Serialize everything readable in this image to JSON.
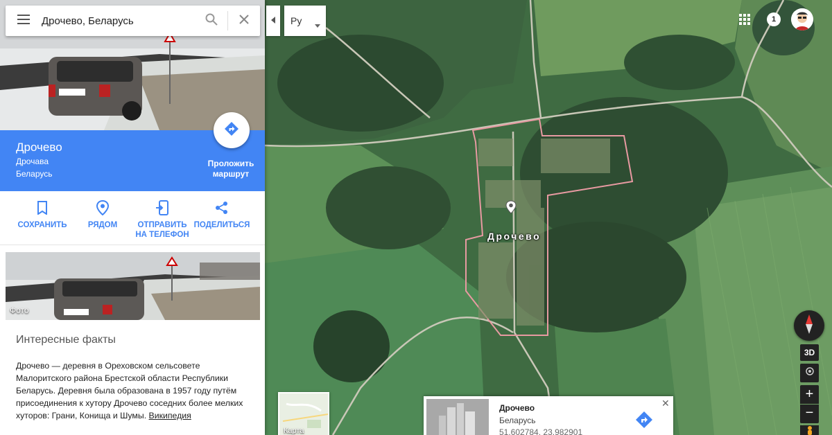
{
  "search": {
    "value": "Дрочево, Беларусь"
  },
  "place": {
    "title": "Дрочево",
    "subtitle": "Дрочава",
    "country": "Беларусь",
    "directions_label": "Проложить\nмаршрут"
  },
  "actions": [
    {
      "label": "СОХРАНИТЬ",
      "icon": "bookmark-icon"
    },
    {
      "label": "РЯДОМ",
      "icon": "nearby-icon"
    },
    {
      "label": "ОТПРАВИТЬ\nНА ТЕЛЕФОН",
      "icon": "send-to-phone-icon"
    },
    {
      "label": "ПОДЕЛИТЬСЯ",
      "icon": "share-icon"
    }
  ],
  "photo": {
    "label": "Фото"
  },
  "facts": {
    "title": "Интересные факты",
    "text": "Дрочево — деревня в Ореховском сельсовете Малоритского района Брестской области Республики Беларусь. Деревня была образована в 1957 году путём присоединения к хутору Дрочево соседних более мелких хуторов: Грани, Конища и Шумы. ",
    "link": "Википедия"
  },
  "language": {
    "value": "Ру"
  },
  "notifications": {
    "count": "1"
  },
  "map": {
    "label": "Дрочево"
  },
  "controls": {
    "three_d": "3D",
    "zoom_in": "+",
    "zoom_out": "−"
  },
  "layer": {
    "label": "Карта"
  },
  "info_card": {
    "name": "Дрочево",
    "country": "Беларусь",
    "coords": "51.602784, 23.982901"
  },
  "colors": {
    "accent": "#4285f4"
  }
}
